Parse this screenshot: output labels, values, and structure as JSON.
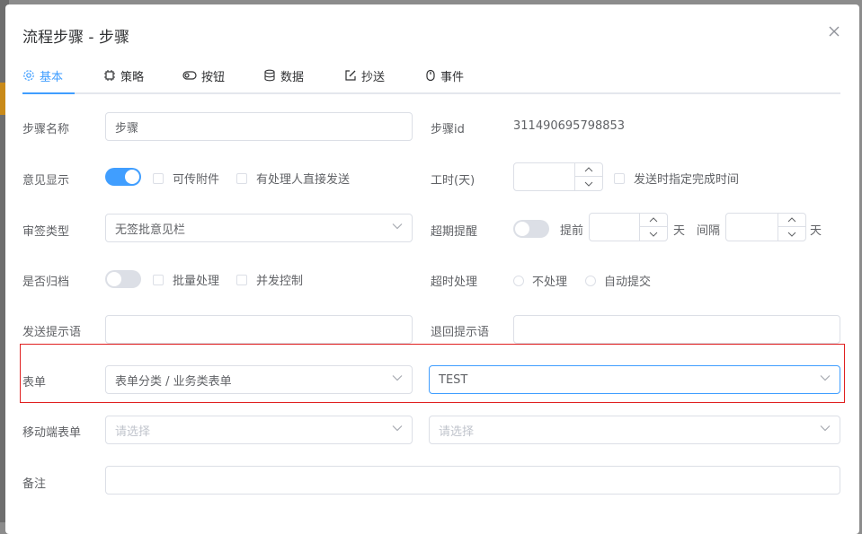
{
  "dialog": {
    "title": "流程步骤 - 步骤"
  },
  "tabs": [
    {
      "label": "基本",
      "icon": "gear-icon",
      "active": true
    },
    {
      "label": "策略",
      "icon": "cpu-icon"
    },
    {
      "label": "按钮",
      "icon": "toggle-icon"
    },
    {
      "label": "数据",
      "icon": "database-icon"
    },
    {
      "label": "抄送",
      "icon": "edit-icon"
    },
    {
      "label": "事件",
      "icon": "mouse-icon"
    }
  ],
  "form": {
    "step_name": {
      "label": "步骤名称",
      "value": "步骤"
    },
    "step_id": {
      "label": "步骤id",
      "value": "311490695798853"
    },
    "opinion": {
      "label": "意见显示",
      "attach": "可传附件",
      "direct_send": "有处理人直接发送"
    },
    "work_hours": {
      "label": "工时(天)",
      "specify_time": "发送时指定完成时间"
    },
    "sign_type": {
      "label": "审签类型",
      "value": "无签批意见栏"
    },
    "overdue": {
      "label": "超期提醒",
      "before": "提前",
      "day1": "天",
      "interval": "间隔",
      "day2": "天"
    },
    "archive": {
      "label": "是否归档",
      "batch": "批量处理",
      "concurrent": "并发控制"
    },
    "timeout": {
      "label": "超时处理",
      "opt1": "不处理",
      "opt2": "自动提交"
    },
    "send_tip": {
      "label": "发送提示语"
    },
    "return_tip": {
      "label": "退回提示语"
    },
    "form_sel": {
      "label": "表单",
      "category": "表单分类 / 业务类表单",
      "value": "TEST"
    },
    "mobile_form": {
      "label": "移动端表单",
      "placeholder1": "请选择",
      "placeholder2": "请选择"
    },
    "remark": {
      "label": "备注"
    }
  },
  "colors": {
    "accent": "#409eff",
    "highlight": "#e02020"
  }
}
